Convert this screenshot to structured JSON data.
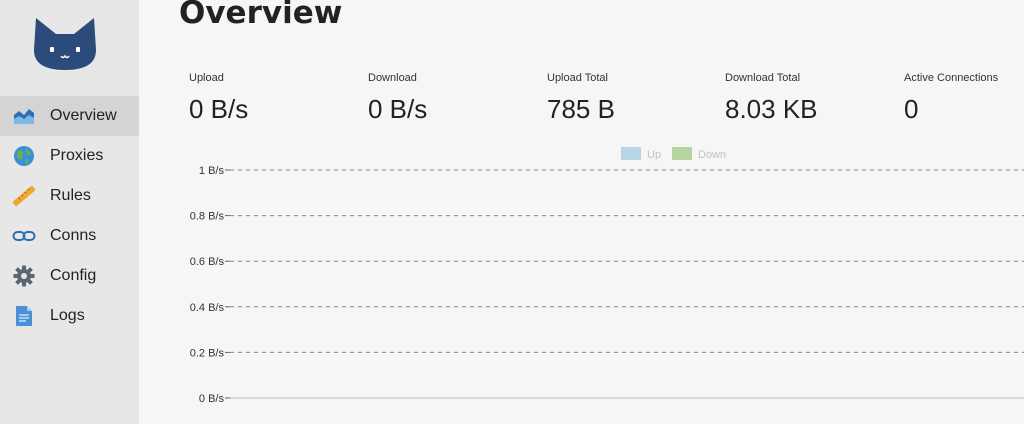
{
  "nav": {
    "items": [
      {
        "label": "Overview",
        "icon": "chart-icon",
        "active": true
      },
      {
        "label": "Proxies",
        "icon": "globe-icon",
        "active": false
      },
      {
        "label": "Rules",
        "icon": "ruler-icon",
        "active": false
      },
      {
        "label": "Conns",
        "icon": "link-icon",
        "active": false
      },
      {
        "label": "Config",
        "icon": "gear-icon",
        "active": false
      },
      {
        "label": "Logs",
        "icon": "document-icon",
        "active": false
      }
    ]
  },
  "page": {
    "title": "Overview"
  },
  "stats": [
    {
      "label": "Upload",
      "value": "0 B/s"
    },
    {
      "label": "Download",
      "value": "0 B/s"
    },
    {
      "label": "Upload Total",
      "value": "785 B"
    },
    {
      "label": "Download Total",
      "value": "8.03 KB"
    },
    {
      "label": "Active Connections",
      "value": "0"
    }
  ],
  "colors": {
    "up": "#b8d5e6",
    "down": "#b6d6a1",
    "accent": "#2c4a7a"
  },
  "chart_data": {
    "type": "line",
    "title": "",
    "xlabel": "",
    "ylabel": "",
    "legend_position": "top-center",
    "grid": true,
    "ylim": [
      0,
      1
    ],
    "yticks": [
      "0 B/s",
      "0.2 B/s",
      "0.4 B/s",
      "0.6 B/s",
      "0.8 B/s",
      "1 B/s"
    ],
    "ytick_values": [
      0,
      0.2,
      0.4,
      0.6,
      0.8,
      1
    ],
    "series": [
      {
        "name": "Up",
        "values": []
      },
      {
        "name": "Down",
        "values": []
      }
    ]
  }
}
